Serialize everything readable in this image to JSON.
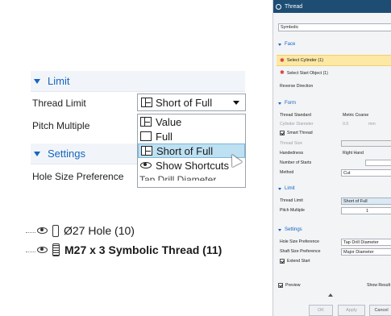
{
  "left_panel": {
    "limit_section": "Limit",
    "thread_limit_label": "Thread Limit",
    "thread_limit_value": "Short of Full",
    "pitch_multiple_label": "Pitch Multiple",
    "settings_section": "Settings",
    "hole_size_pref_label": "Hole Size Preference",
    "dropdown_options": [
      "Value",
      "Full",
      "Short of Full",
      "Show Shortcuts"
    ],
    "dropdown_selected_index": 2,
    "cut_off_item": "Tap Drill Diameter"
  },
  "feature_tree": {
    "items": [
      {
        "label": "Ø27 Hole (10)",
        "bold": false
      },
      {
        "label": "M27 x 3 Symbolic Thread (11)",
        "bold": true
      }
    ]
  },
  "dialog": {
    "title": "Thread",
    "type_value": "Symbolic",
    "face_section": "Face",
    "select_cylinder": "Select Cylinder (1)",
    "select_start": "Select Start Object (1)",
    "reverse_direction": "Reverse Direction",
    "form_section": "Form",
    "thread_standard_label": "Thread Standard",
    "thread_standard_value": "Metric Coarse",
    "cylinder_diameter_label": "Cylinder Diameter",
    "cylinder_diameter_value": "0.0",
    "cylinder_diameter_unit": "mm",
    "smart_thread_label": "Smart Thread",
    "thread_size_label": "Thread Size",
    "handedness_label": "Handedness",
    "handedness_value": "Right Hand",
    "number_of_starts_label": "Number of Starts",
    "method_label": "Method",
    "method_value": "Cut",
    "limit_section": "Limit",
    "thread_limit_label": "Thread Limit",
    "thread_limit_value": "Short of Full",
    "pitch_multiple_label": "Pitch Multiple",
    "pitch_multiple_value": "1",
    "settings_section": "Settings",
    "hole_size_pref_label": "Hole Size Preference",
    "hole_size_pref_value": "Tap Drill Diameter",
    "shaft_size_pref_label": "Shaft Size Preference",
    "shaft_size_pref_value": "Major Diameter",
    "extend_start_label": "Extend Start",
    "preview_label": "Preview",
    "show_result_label": "Show Result",
    "ok_label": "OK",
    "apply_label": "Apply",
    "cancel_label": "Cancel"
  },
  "colors": {
    "accent": "#1565c0",
    "selection": "#bde0f2",
    "title_bar": "#1e4d74",
    "highlight": "#fde8a4"
  }
}
